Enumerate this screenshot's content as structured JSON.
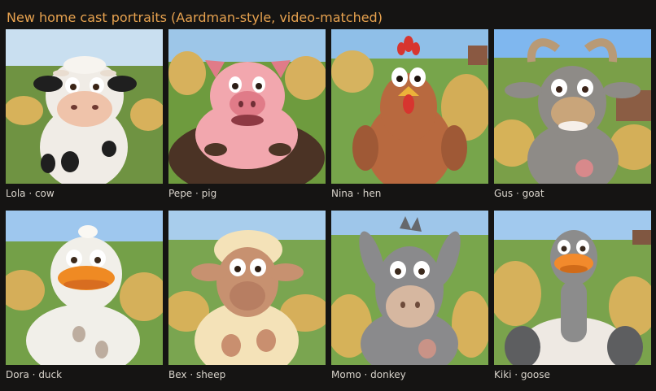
{
  "title": "New home cast portraits (Aardman-style, video-matched)",
  "cards": [
    {
      "caption": "Lola · cow",
      "body_color": "#f0ece6",
      "accent_color": "#1f1f1f",
      "sky_color": "#c9dff0"
    },
    {
      "caption": "Pepe · pig",
      "body_color": "#f2a7ae",
      "accent_color": "#e07b88",
      "sky_color": "#9dc6e8"
    },
    {
      "caption": "Nina · hen",
      "body_color": "#b8693f",
      "accent_color": "#d7352f",
      "sky_color": "#8fbfe8"
    },
    {
      "caption": "Gus · goat",
      "body_color": "#8e8b87",
      "accent_color": "#c9a57a",
      "sky_color": "#7fb7ef"
    },
    {
      "caption": "Dora · duck",
      "body_color": "#f1efe9",
      "accent_color": "#ef8a23",
      "sky_color": "#9ec7ee"
    },
    {
      "caption": "Bex · sheep",
      "body_color": "#f4e2b8",
      "accent_color": "#c79170",
      "sky_color": "#a8cdec"
    },
    {
      "caption": "Momo · donkey",
      "body_color": "#8a8a8c",
      "accent_color": "#d6b7a0",
      "sky_color": "#9ec6ea"
    },
    {
      "caption": "Kiki · goose",
      "body_color": "#8c8c8c",
      "accent_color": "#f28a2c",
      "sky_color": "#a1c9ee"
    }
  ]
}
